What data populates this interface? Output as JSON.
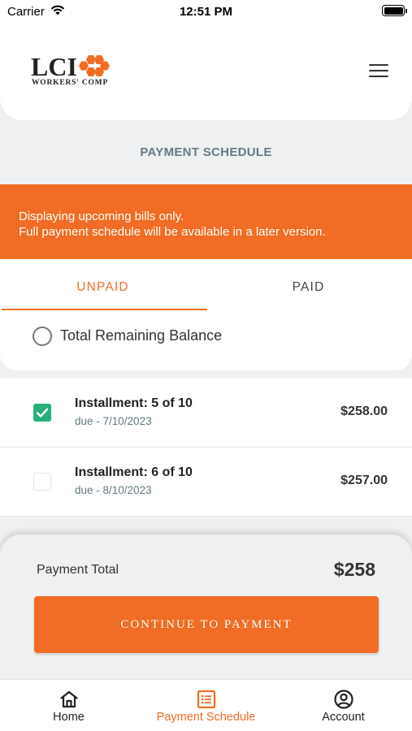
{
  "status_bar": {
    "carrier": "Carrier",
    "time": "12:51 PM"
  },
  "brand": {
    "logo_text": "LCI",
    "logo_subtext": "WORKERS' COMP",
    "accent_color": "#f16c24"
  },
  "header": {
    "menu_icon": "hamburger-menu-icon"
  },
  "page": {
    "title": "PAYMENT SCHEDULE"
  },
  "banner": {
    "line1": "Displaying upcoming bills only.",
    "line2": "Full payment schedule will be available in a later version."
  },
  "tabs": [
    {
      "label": "UNPAID",
      "active": true
    },
    {
      "label": "PAID",
      "active": false
    }
  ],
  "total_option": {
    "label": "Total Remaining Balance",
    "selected": false
  },
  "installments": [
    {
      "title": "Installment: 5 of 10",
      "due": "due - 7/10/2023",
      "amount": "$258.00",
      "checked": true
    },
    {
      "title": "Installment: 6 of 10",
      "due": "due - 8/10/2023",
      "amount": "$257.00",
      "checked": false
    }
  ],
  "payment": {
    "label": "Payment Total",
    "total": "$258",
    "button_label": "CONTINUE TO PAYMENT"
  },
  "bottom_nav": [
    {
      "label": "Home",
      "icon": "home-icon",
      "active": false
    },
    {
      "label": "Payment Schedule",
      "icon": "schedule-icon",
      "active": true
    },
    {
      "label": "Account",
      "icon": "account-icon",
      "active": false
    }
  ]
}
